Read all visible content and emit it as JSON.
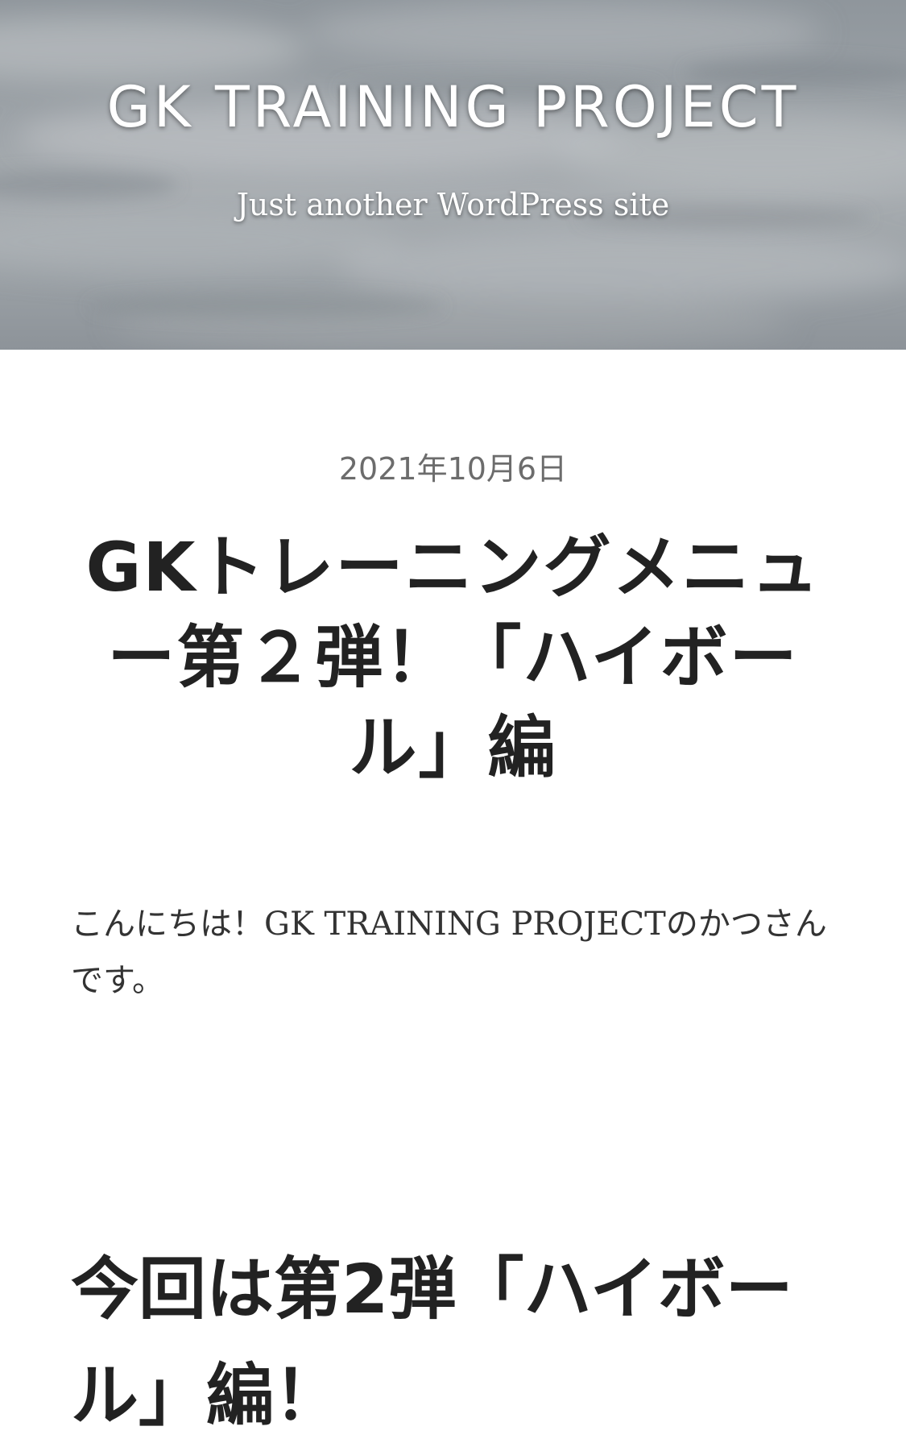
{
  "header": {
    "site_title": "GK TRAINING PROJECT",
    "tagline": "Just another WordPress site"
  },
  "post": {
    "date": "2021年10月6日",
    "title": "GKトレーニングメニュー第２弾！「ハイボール」編",
    "intro": "こんにちは！GK TRAINING PROJECTのかつさんです。",
    "section_heading": "今回は第2弾「ハイボール」編！"
  }
}
